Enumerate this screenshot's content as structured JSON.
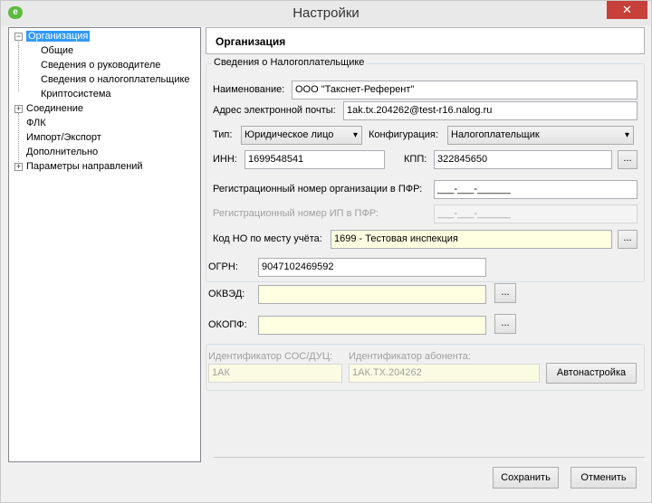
{
  "window": {
    "title": "Настройки",
    "close_symbol": "✕",
    "app_icon_letter": "e",
    "brand_color": "#5dbb3f",
    "close_color": "#c7403a"
  },
  "tree": {
    "org": "Организация",
    "common": "Общие",
    "head": "Сведения о руководителе",
    "taxpayer": "Сведения о налогоплательщике",
    "crypto": "Криптосистема",
    "conn": "Соединение",
    "flk": "ФЛК",
    "impexp": "Импорт/Экспорт",
    "extra": "Дополнительно",
    "dirs": "Параметры направлений",
    "expanded_sign": "−",
    "collapsed_sign": "+"
  },
  "panel": {
    "title": "Организация",
    "group_title": "Сведения о Налогоплательщике",
    "name_label": "Наименование:",
    "name_value": "ООО \"Такснет-Референт\"",
    "email_label": "Адрес электронной почты:",
    "email_value": "1ak.tx.204262@test-r16.nalog.ru",
    "type_label": "Тип:",
    "type_value": "Юридическое лицо",
    "config_label": "Конфигурация:",
    "config_value": "Налогоплательщик",
    "inn_label": "ИНН:",
    "inn_value": "1699548541",
    "kpp_label": "КПП:",
    "kpp_value": "322845650",
    "pfr_org_label": "Регистрационный номер организации в ПФР:",
    "pfr_org_value": "___-___-______",
    "pfr_ip_label": "Регистрационный номер ИП в ПФР:",
    "pfr_ip_value": "___-___-______",
    "ho_label": "Код НО по месту учёта:",
    "ho_value": "1699 - Тестовая инспекция",
    "ogrn_label": "ОГРН:",
    "ogrn_value": "9047102469592",
    "okved_label": "ОКВЭД:",
    "okved_value": "",
    "okopf_label": "ОКОПФ:",
    "okopf_value": "",
    "sos_label": "Идентификатор СОС/ДУЦ:",
    "sos_value": "1АК",
    "abon_label": "Идентификатор абонента:",
    "abon_value": "1АК.ТХ.204262",
    "autoconf": "Автонастройка",
    "ellipsis": "...",
    "arrow": "▾"
  },
  "footer": {
    "save": "Сохранить",
    "cancel": "Отменить"
  }
}
